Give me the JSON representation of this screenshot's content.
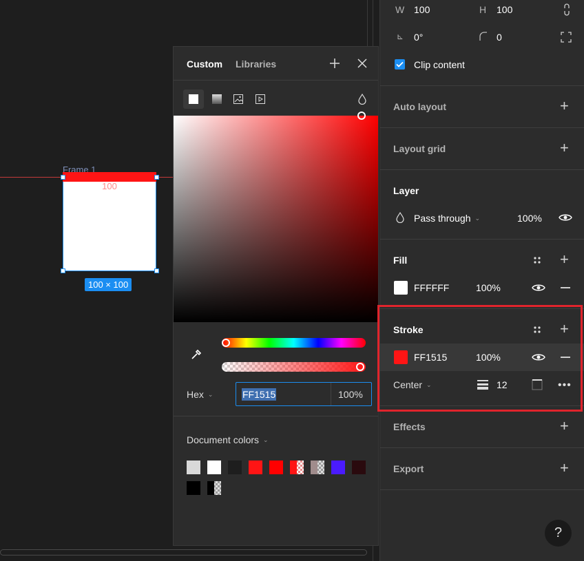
{
  "canvas": {
    "frame_label": "Frame 1",
    "frame_inner_text": "100",
    "size_badge": "100 × 100"
  },
  "picker": {
    "tabs": [
      "Custom",
      "Libraries"
    ],
    "hex_mode_label": "Hex",
    "hex_value": "FF1515",
    "opacity": "100%",
    "document_colors_label": "Document colors",
    "swatches_row1": [
      "#d9d9d9",
      "#ffffff",
      "#1e1e1e",
      "#ff1515",
      "#ff0000",
      "split-red",
      "split-gray",
      "#4a1bff",
      "#2a0a0e"
    ],
    "swatches_row2": [
      "#000000",
      "split-black"
    ]
  },
  "panel": {
    "w_label": "W",
    "w_value": "100",
    "h_label": "H",
    "h_value": "100",
    "rotation_value": "0°",
    "radius_value": "0",
    "clip_content": "Clip content",
    "auto_layout": "Auto layout",
    "layout_grid": "Layout grid",
    "layer": {
      "title": "Layer",
      "blend": "Pass through",
      "opacity": "100%"
    },
    "fill": {
      "title": "Fill",
      "hex": "FFFFFF",
      "opacity": "100%",
      "color": "#ffffff"
    },
    "stroke": {
      "title": "Stroke",
      "hex": "FF1515",
      "opacity": "100%",
      "color": "#ff1515",
      "position": "Center",
      "weight": "12"
    },
    "effects": "Effects",
    "export": "Export",
    "help": "?"
  },
  "colors": {
    "accent": "#1b8ef2",
    "highlight": "#e0242c",
    "panel_bg": "#2c2c2c",
    "canvas_bg": "#1e1e1e"
  }
}
